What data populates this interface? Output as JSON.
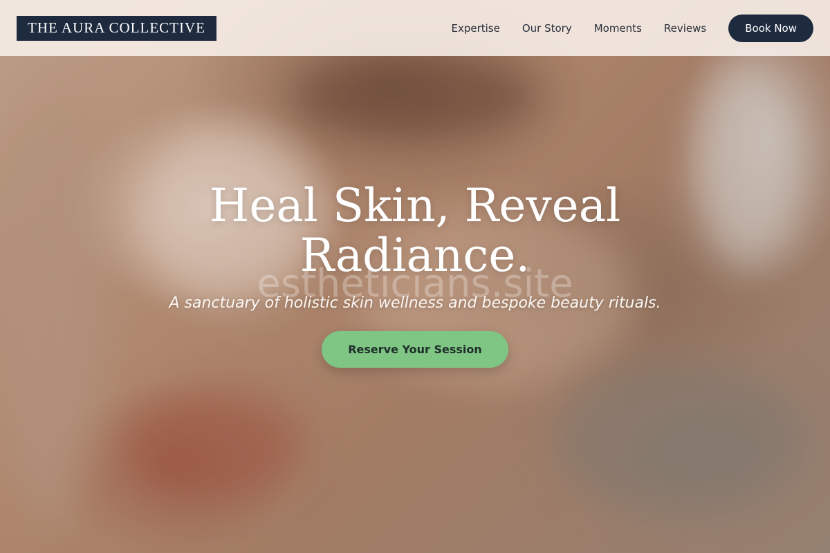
{
  "brand": {
    "logo_text": "THE AURA COLLECTIVE"
  },
  "nav": {
    "items": [
      {
        "label": "Expertise"
      },
      {
        "label": "Our Story"
      },
      {
        "label": "Moments"
      },
      {
        "label": "Reviews"
      }
    ],
    "book_label": "Book Now"
  },
  "hero": {
    "headline_line1": "Heal Skin, Reveal",
    "headline_line2": "Radiance.",
    "watermark": "estheticians.site",
    "tagline": "A sanctuary of holistic skin wellness and bespoke beauty rituals.",
    "cta_label": "Reserve Your Session"
  },
  "colors": {
    "brand_navy": "#1e2a3e",
    "cta_green": "#7fc584",
    "header_bg": "#f8f0ea"
  }
}
